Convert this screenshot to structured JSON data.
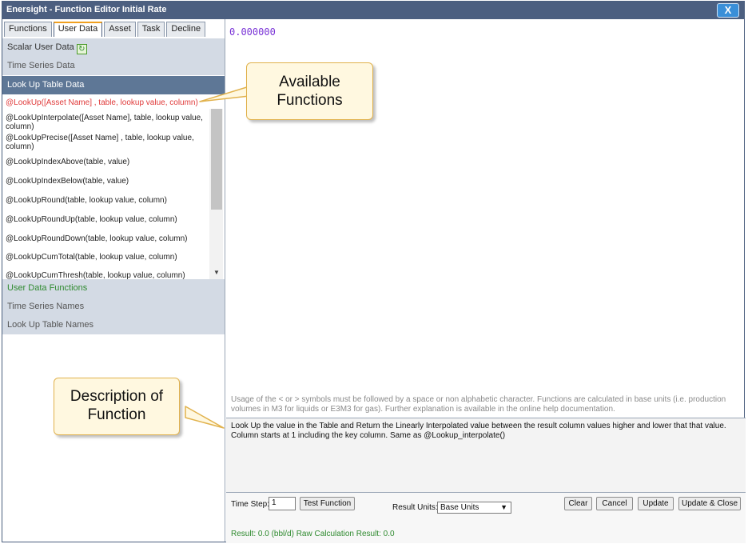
{
  "window": {
    "title": "Enersight - Function Editor  Initial Rate",
    "close_label": "X"
  },
  "tabs": [
    "Functions",
    "User Data",
    "Asset",
    "Task",
    "Decline"
  ],
  "active_tab": "User Data",
  "sections": {
    "scalar_user_data": "Scalar User Data",
    "time_series_data": "Time Series Data",
    "look_up_table_data": "Look Up Table Data",
    "user_data_functions": "User Data Functions",
    "time_series_names": "Time Series Names",
    "look_up_table_names": "Look Up Table Names"
  },
  "functions": [
    "@LookUp([Asset Name] , table, lookup value, column)",
    "@LookUpInterpolate([Asset Name], table, lookup value, column)",
    "@LookUpPrecise([Asset Name] , table, lookup value, column)",
    "@LookUpIndexAbove(table, value)",
    "@LookUpIndexBelow(table, value)",
    "@LookUpRound(table, lookup value, column)",
    "@LookUpRoundUp(table, lookup value, column)",
    "@LookUpRoundDown(table, lookup value, column)",
    "@LookUpCumTotal(table, lookup value, column)",
    "@LookUpCumThresh(table, lookup value, column)"
  ],
  "selected_function": "@LookUp([Asset Name] , table, lookup value, column)",
  "editor": {
    "value": "0.000000"
  },
  "usage_note": "Usage of the < or > symbols must be followed by a space or non alphabetic character. Functions are calculated in base units (i.e. production volumes in M3 for liquids or E3M3 for gas). Further explanation is available in the online help documentation.",
  "description": "Look Up the value in the Table and Return the Linearly Interpolated value between the result column values higher and lower that that value. Column starts at 1 including the key column. Same as @Lookup_interpolate()",
  "controls": {
    "time_step_label": "Time Step:",
    "time_step_value": "1",
    "test_function": "Test Function",
    "result_units_label": "Result Units:",
    "result_units_value": "Base Units",
    "clear": "Clear",
    "cancel": "Cancel",
    "update": "Update",
    "update_close": "Update & Close",
    "result_text": "Result: 0.0 (bbl/d)  Raw Calculation Result: 0.0"
  },
  "callouts": {
    "available_functions": "Available Functions",
    "description_of_function": "Description of Function"
  },
  "colors": {
    "titlebar": "#4c5f80",
    "close_button": "#3a8fd8",
    "selected_section": "#5e7796",
    "section_header": "#d3dae4",
    "selected_function_text": "#e03a3a",
    "editor_value": "#7a34d6",
    "green_text": "#2f8a2f",
    "callout_fill": "#fff8e0",
    "callout_border": "#e1b24d"
  }
}
